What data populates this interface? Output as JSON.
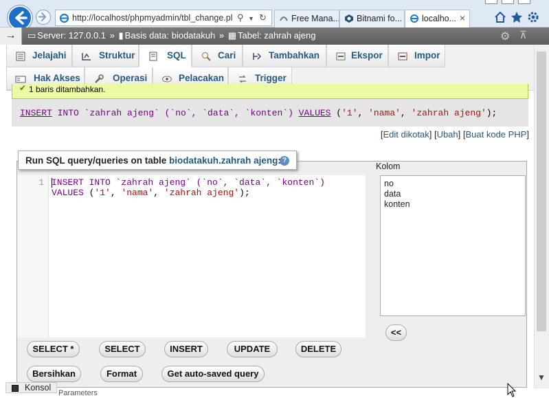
{
  "browser": {
    "address": "http://localhost/phpmyadmin/tbl_change.pl",
    "tabs": [
      {
        "label": "Free Mana..."
      },
      {
        "label": "Bitnami fo..."
      },
      {
        "label": "localho..."
      }
    ],
    "close_label": "×"
  },
  "server_bar": {
    "arrow": "→",
    "server": "Server: 127.0.0.1",
    "sep1": "»",
    "database": "Basis data: biodatakuh",
    "sep2": "»",
    "table": "Tabel: zahrah ajeng"
  },
  "menu": {
    "row1": [
      "Jelajahi",
      "Struktur",
      "SQL",
      "Cari",
      "Tambahkan",
      "Ekspor",
      "Impor"
    ],
    "row2": [
      "Hak Akses",
      "Operasi",
      "Pelacakan",
      "Trigger"
    ]
  },
  "success": {
    "message": "1 baris ditambahkan."
  },
  "executed_sql": {
    "p1": "INSERT",
    "p2": " INTO `zahrah ajeng` (`no`, `data`, `konten`) ",
    "p3": "VALUES",
    "p4": " (",
    "s1": "'1'",
    "c1": ", ",
    "s2": "'nama'",
    "c2": ", ",
    "s3": "'zahrah ajeng'",
    "p5": ");"
  },
  "links": {
    "open1": "[",
    "edit_inline": "Edit dikotak",
    "close1": "] [",
    "edit": "Ubah",
    "close2": "] [",
    "php": "Buat kode PHP",
    "close3": "]"
  },
  "query_box": {
    "legend_prefix": "Run SQL query/queries on table ",
    "legend_table": "biodatakuh.zahrah ajeng",
    "legend_suffix": ":",
    "help": "?",
    "line_number": "1",
    "line1_kw1": "INSERT INTO",
    "line1_rest": " `zahrah ajeng` (`no`, `data`, `konten`)",
    "line2_kw": "VALUES",
    "line2_open": " (",
    "line2_s1": "'1'",
    "line2_c1": ", ",
    "line2_s2": "'nama'",
    "line2_c2": ", ",
    "line2_s3": "'zahrah ajeng'",
    "line2_close": ");"
  },
  "columns": {
    "label": "Kolom",
    "items": [
      "no",
      "data",
      "konten"
    ],
    "insert_button": "<<"
  },
  "buttons": {
    "row1": [
      "SELECT *",
      "SELECT",
      "INSERT",
      "UPDATE",
      "DELETE"
    ],
    "row2": [
      "Bersihkan",
      "Format",
      "Get auto-saved query"
    ]
  },
  "console": {
    "label": "Konsol"
  },
  "footer_partial": "Parameters"
}
